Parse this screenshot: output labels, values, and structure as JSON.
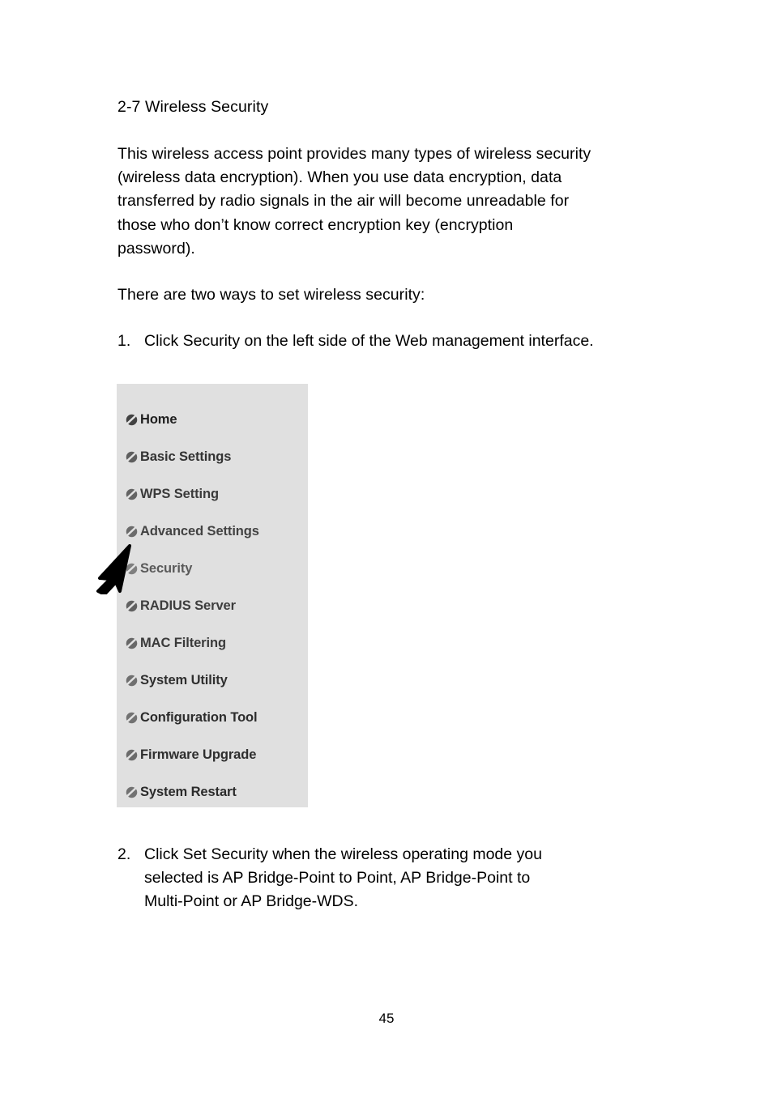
{
  "document": {
    "section_title": "2-7 Wireless Security",
    "page_number": "45"
  },
  "intro_paragraph": {
    "lines": [
      "This wireless access point provides many types of wireless security",
      "(wireless data encryption). When you use data encryption, data",
      "transferred by radio signals in the air will become unreadable for",
      "those who don’t know correct encryption key (encryption",
      "password)."
    ]
  },
  "ways_paragraph": {
    "lines": [
      "There are two ways to set wireless security:"
    ]
  },
  "steps": [
    {
      "number": "1.",
      "lines": [
        "Click Security on the left side of the Web management interface."
      ]
    },
    {
      "number": "2.",
      "lines": [
        "Click Set Security when the wireless operating mode you",
        "selected is AP Bridge-Point to Point, AP Bridge-Point to",
        "Multi-Point or AP Bridge-WDS."
      ]
    }
  ],
  "menu_panel": {
    "background_color": "#e0e0e0",
    "bullet_icon": "disc-slash-icon",
    "items": [
      {
        "label": "Home"
      },
      {
        "label": "Basic Settings"
      },
      {
        "label": "WPS Setting"
      },
      {
        "label": "Advanced Settings"
      },
      {
        "label": "Security"
      },
      {
        "label": "RADIUS Server"
      },
      {
        "label": "MAC Filtering"
      },
      {
        "label": "System Utility"
      },
      {
        "label": "Configuration Tool"
      },
      {
        "label": "Firmware Upgrade"
      },
      {
        "label": "System Restart"
      }
    ]
  },
  "annotation": {
    "pointer_icon": "arrow-cursor-icon",
    "points_at": "Security"
  }
}
